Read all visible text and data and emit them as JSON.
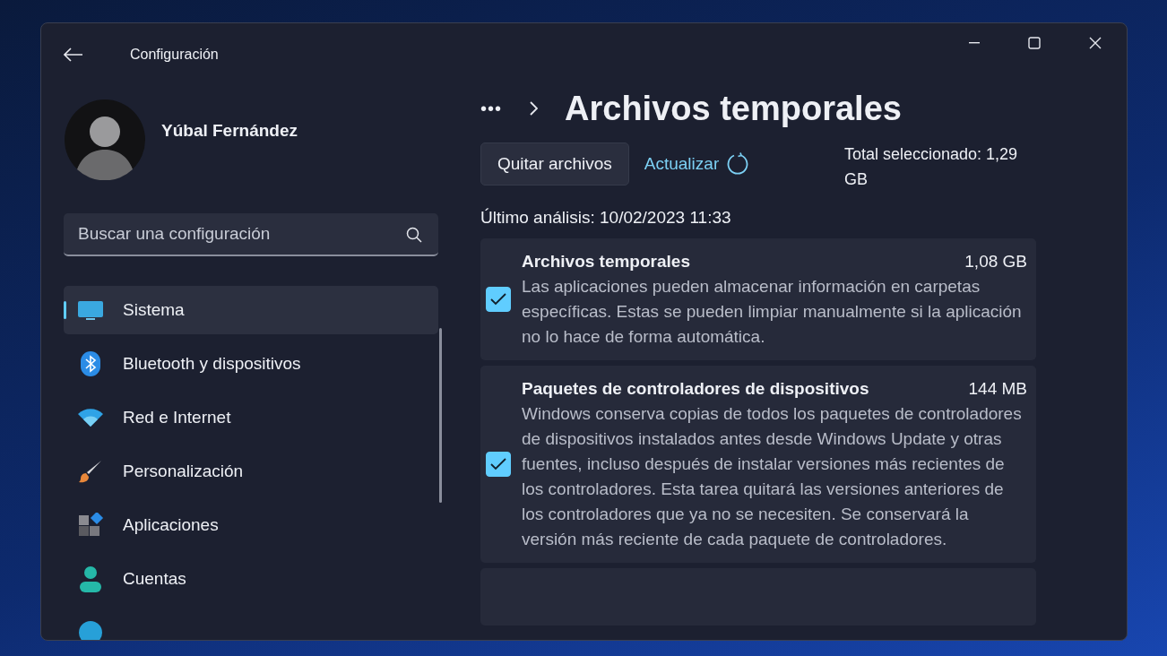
{
  "window": {
    "title": "Configuración"
  },
  "profile": {
    "name": "Yúbal Fernández"
  },
  "search": {
    "placeholder": "Buscar una configuración"
  },
  "nav": [
    {
      "label": "Sistema",
      "selected": true
    },
    {
      "label": "Bluetooth y dispositivos",
      "selected": false
    },
    {
      "label": "Red e Internet",
      "selected": false
    },
    {
      "label": "Personalización",
      "selected": false
    },
    {
      "label": "Aplicaciones",
      "selected": false
    },
    {
      "label": "Cuentas",
      "selected": false
    },
    {
      "selected": false
    }
  ],
  "breadcrumb": {
    "more": "•••",
    "title": "Archivos temporales"
  },
  "actions": {
    "remove_button": "Quitar archivos",
    "refresh_link": "Actualizar",
    "total": "Total seleccionado: 1,29 GB"
  },
  "last_scan": "Último análisis: 10/02/2023 11:33",
  "items": [
    {
      "title": "Archivos temporales",
      "size": "1,08 GB",
      "description": "Las aplicaciones pueden almacenar información en carpetas específicas. Estas se pueden limpiar manualmente si la aplicación no lo hace de forma automática.",
      "checked": true
    },
    {
      "title": "Paquetes de controladores de dispositivos",
      "size": "144 MB",
      "description": "Windows conserva copias de todos los paquetes de controladores de dispositivos instalados antes desde Windows Update y otras fuentes, incluso después de instalar versiones más recientes de los controladores. Esta tarea quitará las versiones anteriores de los controladores que ya no se necesiten. Se conservará la versión más reciente de cada paquete de controladores.",
      "checked": true
    }
  ]
}
